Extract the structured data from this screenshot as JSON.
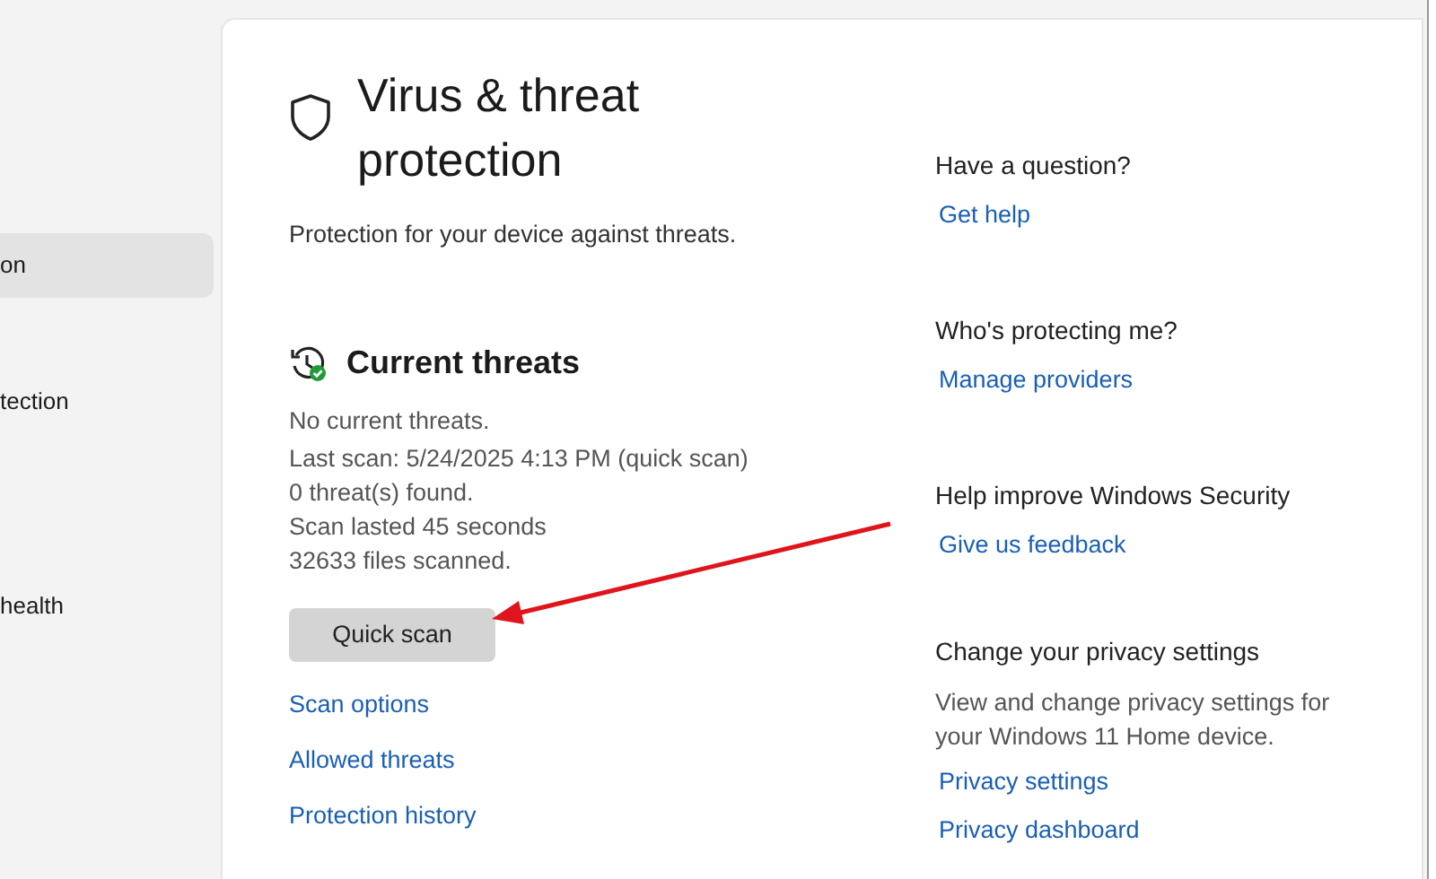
{
  "sidebar": {
    "items": [
      {
        "label": "on",
        "selected": true
      },
      {
        "label": "tection",
        "selected": false
      },
      {
        "label": "health",
        "selected": false
      }
    ]
  },
  "page": {
    "title": "Virus & threat protection",
    "subtitle": "Protection for your device against threats."
  },
  "current_threats": {
    "heading": "Current threats",
    "lines": [
      "No current threats.",
      "Last scan: 5/24/2025 4:13 PM (quick scan)",
      "0 threat(s) found.",
      "Scan lasted 45 seconds",
      "32633 files scanned."
    ],
    "button": "Quick scan",
    "links": [
      "Scan options",
      "Allowed threats",
      "Protection history"
    ]
  },
  "side_sections": [
    {
      "heading": "Have a question?",
      "links": [
        "Get help"
      ]
    },
    {
      "heading": "Who's protecting me?",
      "links": [
        "Manage providers"
      ]
    },
    {
      "heading": "Help improve Windows Security",
      "links": [
        "Give us feedback"
      ]
    },
    {
      "heading": "Change your privacy settings",
      "text": "View and change privacy settings for your Windows 11 Home device.",
      "links": [
        "Privacy settings",
        "Privacy dashboard"
      ]
    }
  ]
}
